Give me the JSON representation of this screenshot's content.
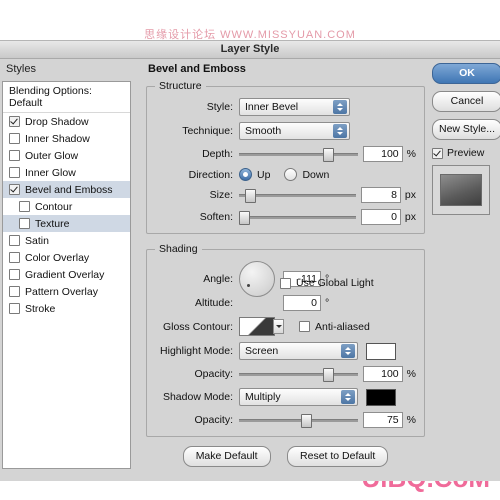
{
  "watermarks": {
    "top": "思缘设计论坛 WWW.MISSYUAN.COM",
    "bottom": "UiBQ.CoM"
  },
  "dialog": {
    "title": "Layer Style"
  },
  "styles_panel": {
    "header": "Styles",
    "blending_options": "Blending Options: Default",
    "items": [
      {
        "label": "Drop Shadow",
        "checked": true,
        "indent": false,
        "selected": false
      },
      {
        "label": "Inner Shadow",
        "checked": false,
        "indent": false,
        "selected": false
      },
      {
        "label": "Outer Glow",
        "checked": false,
        "indent": false,
        "selected": false
      },
      {
        "label": "Inner Glow",
        "checked": false,
        "indent": false,
        "selected": false
      },
      {
        "label": "Bevel and Emboss",
        "checked": true,
        "indent": false,
        "selected": true
      },
      {
        "label": "Contour",
        "checked": false,
        "indent": true,
        "selected": false
      },
      {
        "label": "Texture",
        "checked": false,
        "indent": true,
        "selected": true
      },
      {
        "label": "Satin",
        "checked": false,
        "indent": false,
        "selected": false
      },
      {
        "label": "Color Overlay",
        "checked": false,
        "indent": false,
        "selected": false
      },
      {
        "label": "Gradient Overlay",
        "checked": false,
        "indent": false,
        "selected": false
      },
      {
        "label": "Pattern Overlay",
        "checked": false,
        "indent": false,
        "selected": false
      },
      {
        "label": "Stroke",
        "checked": false,
        "indent": false,
        "selected": false
      }
    ]
  },
  "main": {
    "title": "Bevel and Emboss",
    "structure": {
      "legend": "Structure",
      "style_label": "Style:",
      "style_value": "Inner Bevel",
      "technique_label": "Technique:",
      "technique_value": "Smooth",
      "depth_label": "Depth:",
      "depth_value": "100",
      "depth_unit": "%",
      "direction_label": "Direction:",
      "direction_up": "Up",
      "direction_down": "Down",
      "size_label": "Size:",
      "size_value": "8",
      "size_unit": "px",
      "soften_label": "Soften:",
      "soften_value": "0",
      "soften_unit": "px"
    },
    "shading": {
      "legend": "Shading",
      "angle_label": "Angle:",
      "angle_value": "-111",
      "angle_unit": "°",
      "use_global_light": "Use Global Light",
      "altitude_label": "Altitude:",
      "altitude_value": "0",
      "altitude_unit": "°",
      "gloss_contour_label": "Gloss Contour:",
      "anti_aliased": "Anti-aliased",
      "highlight_mode_label": "Highlight Mode:",
      "highlight_mode_value": "Screen",
      "highlight_opacity_label": "Opacity:",
      "highlight_opacity_value": "100",
      "highlight_opacity_unit": "%",
      "shadow_mode_label": "Shadow Mode:",
      "shadow_mode_value": "Multiply",
      "shadow_opacity_label": "Opacity:",
      "shadow_opacity_value": "75",
      "shadow_opacity_unit": "%",
      "highlight_color": "#ffffff",
      "shadow_color": "#000000"
    },
    "make_default": "Make Default",
    "reset_to_default": "Reset to Default"
  },
  "right": {
    "ok": "OK",
    "cancel": "Cancel",
    "new_style": "New Style...",
    "preview": "Preview",
    "preview_checked": true
  }
}
